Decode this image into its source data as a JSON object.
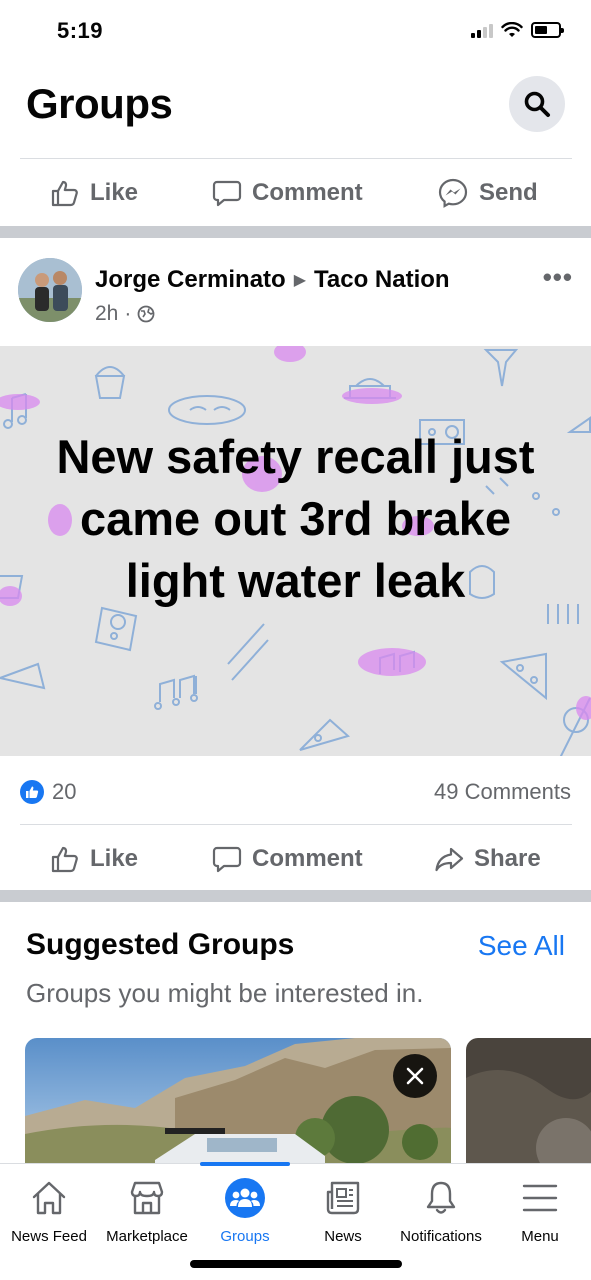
{
  "status_bar": {
    "time": "5:19",
    "battery_level": 0.55
  },
  "header": {
    "title": "Groups"
  },
  "top_actions": {
    "like": "Like",
    "comment": "Comment",
    "send": "Send"
  },
  "post": {
    "author": "Jorge Cerminato",
    "group": "Taco Nation",
    "time": "2h",
    "separator": "·",
    "text": "New safety recall just came out 3rd brake light water leak",
    "background_color": "#e4e4e4",
    "reaction_count": "20",
    "comment_count": "49 Comments",
    "actions": {
      "like": "Like",
      "comment": "Comment",
      "share": "Share"
    }
  },
  "suggested": {
    "title": "Suggested Groups",
    "see_all": "See All",
    "subtitle": "Groups you might be interested in."
  },
  "tabs": [
    {
      "label": "News Feed",
      "icon": "home-icon"
    },
    {
      "label": "Marketplace",
      "icon": "marketplace-icon"
    },
    {
      "label": "Groups",
      "icon": "groups-icon",
      "active": true
    },
    {
      "label": "News",
      "icon": "news-icon"
    },
    {
      "label": "Notifications",
      "icon": "bell-icon"
    },
    {
      "label": "Menu",
      "icon": "menu-icon"
    }
  ],
  "colors": {
    "accent": "#1877f2",
    "secondary_text": "#65676b",
    "divider": "#c9ccd1"
  }
}
